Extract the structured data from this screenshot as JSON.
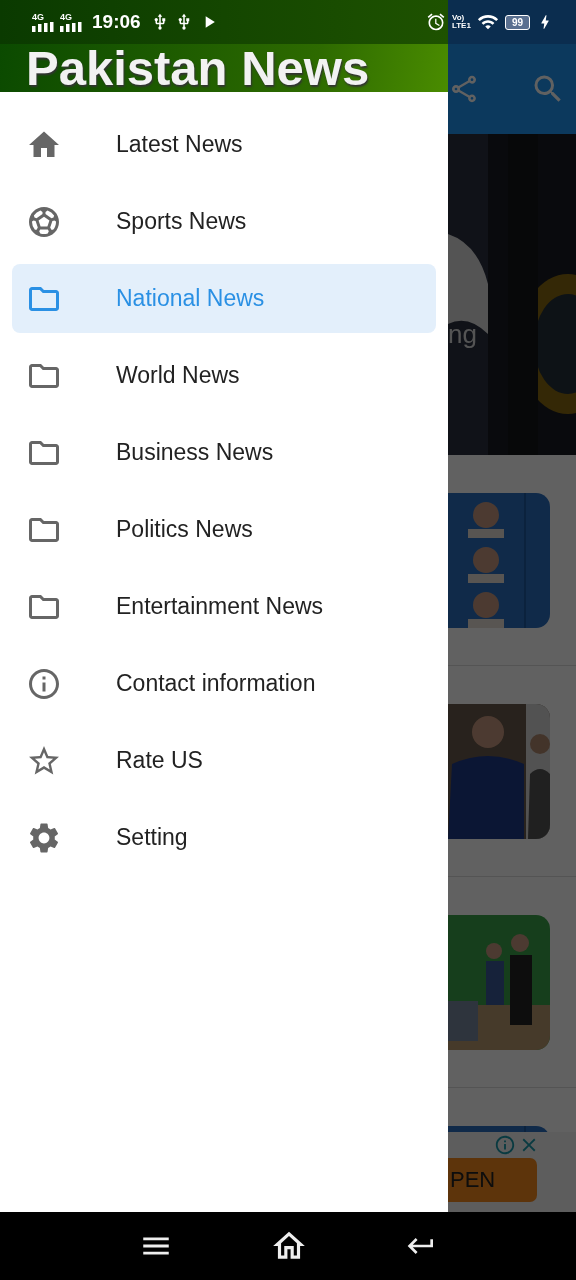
{
  "status_bar": {
    "networks": [
      {
        "label": "4G"
      },
      {
        "label": "4G"
      }
    ],
    "time": "19:06",
    "volte": [
      "Vo)",
      "LTE1"
    ],
    "battery": "99"
  },
  "drawer": {
    "title": "Pakistan News",
    "items": [
      {
        "label": "Latest News",
        "kind": "home",
        "selected": false
      },
      {
        "label": "Sports News",
        "kind": "sports",
        "selected": false
      },
      {
        "label": "National News",
        "kind": "category",
        "selected": true
      },
      {
        "label": "World News",
        "kind": "category",
        "selected": false
      },
      {
        "label": "Business News",
        "kind": "category",
        "selected": false
      },
      {
        "label": "Politics News",
        "kind": "category",
        "selected": false
      },
      {
        "label": "Entertainment News",
        "kind": "category",
        "selected": false
      },
      {
        "label": "Contact information",
        "kind": "contact",
        "selected": false
      },
      {
        "label": "Rate US",
        "kind": "rate",
        "selected": false
      },
      {
        "label": "Setting",
        "kind": "settings",
        "selected": false
      }
    ]
  },
  "main": {
    "hero_caption": "ng",
    "ad": {
      "button": "PEN"
    }
  }
}
